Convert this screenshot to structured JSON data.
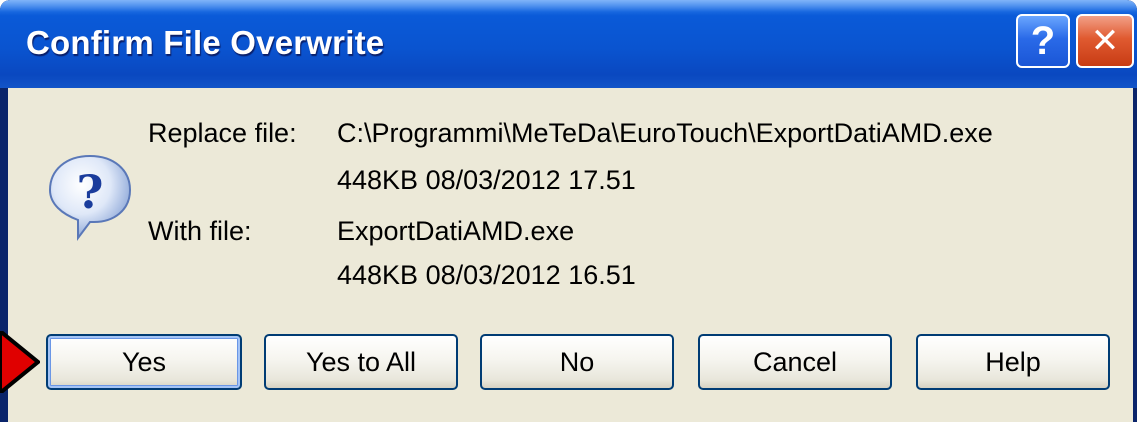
{
  "window": {
    "title": "Confirm File Overwrite",
    "help_glyph": "?",
    "close_glyph": "✕"
  },
  "icon": "question-icon",
  "replace": {
    "label": "Replace file:",
    "path": "C:\\Programmi\\MeTeDa\\EuroTouch\\ExportDatiAMD.exe",
    "info": "448KB  08/03/2012  17.51"
  },
  "with": {
    "label": "With file:",
    "name": "ExportDatiAMD.exe",
    "info": "448KB  08/03/2012  16.51"
  },
  "buttons": {
    "yes": "Yes",
    "yes_to_all": "Yes to All",
    "no": "No",
    "cancel": "Cancel",
    "help": "Help"
  },
  "colors": {
    "titlebar": "#0a54d0",
    "client": "#ece9d8",
    "close": "#e05a30",
    "pointer": "#e00000"
  }
}
